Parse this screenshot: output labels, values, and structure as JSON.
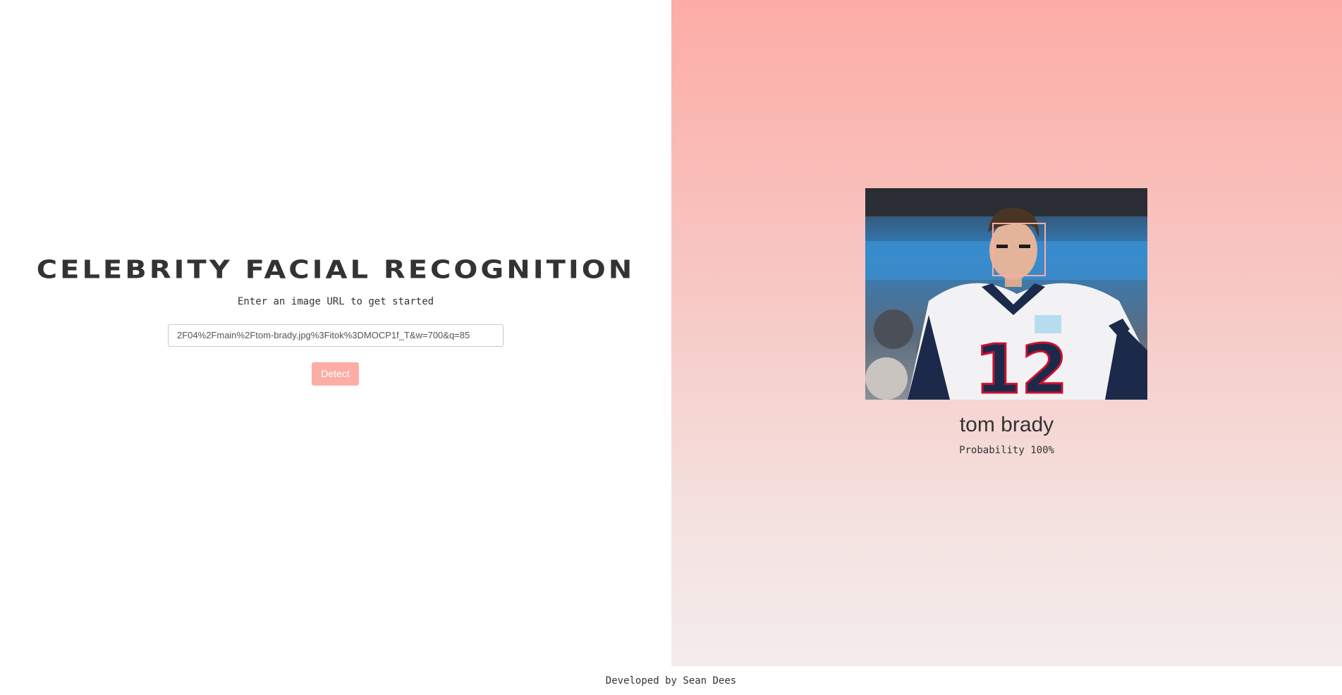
{
  "app": {
    "title": "CELEBRITY FACIAL RECOGNITION",
    "subtitle": "Enter an image URL to get started"
  },
  "form": {
    "url_value": "2F04%2Fmain%2Ftom-brady.jpg%3Fitok%3DMOCP1f_T&w=700&q=85",
    "detect_label": "Detect"
  },
  "result": {
    "name": "tom brady",
    "probability_label": "Probability",
    "probability_value": "100%"
  },
  "footer": {
    "credit": "Developed by Sean Dees"
  },
  "colors": {
    "accent": "#fdaca6",
    "text": "#333333"
  }
}
